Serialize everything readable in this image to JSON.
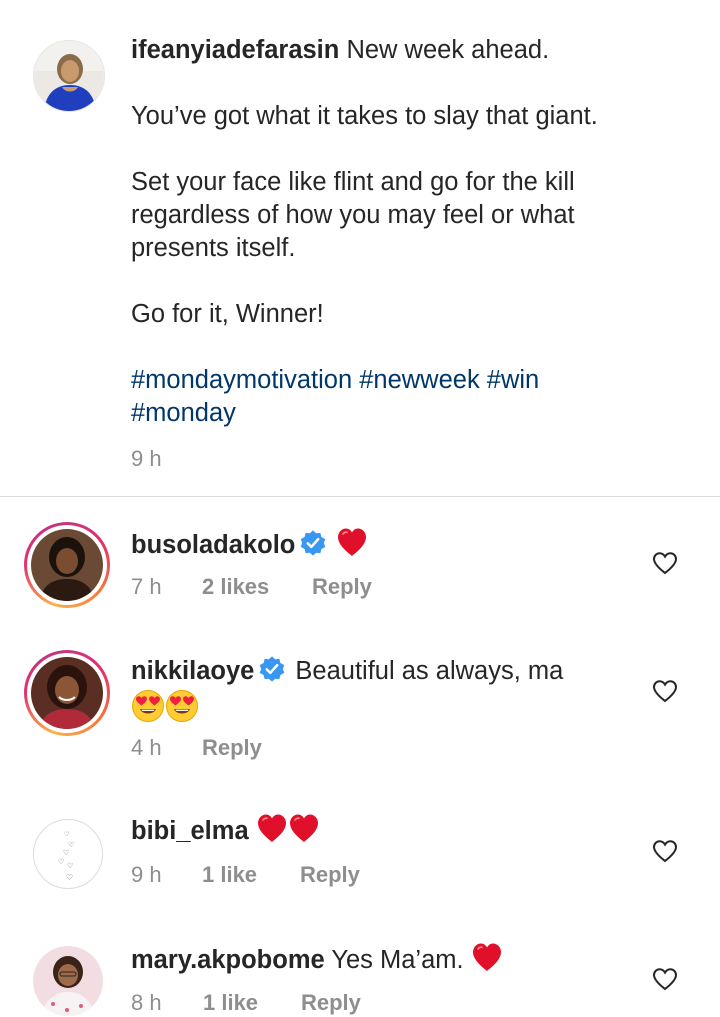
{
  "caption": {
    "username": "ifeanyiadefarasin",
    "first_line": "New week ahead.",
    "paragraph2": "You’ve got what it takes to slay that giant.",
    "paragraph3_line1": "Set your face like flint and go for the kill",
    "paragraph3_line2": "regardless of how you may feel or what",
    "paragraph3_line3": "presents itself.",
    "paragraph4": "Go for it, Winner!",
    "hashtags_line1": "#mondaymotivation #newweek #win",
    "hashtags_line2": "#monday",
    "time": "9 h"
  },
  "comments": [
    {
      "username": "busoladakolo",
      "verified": true,
      "text": "❤️",
      "time": "7 h",
      "likes": "2 likes",
      "reply": "Reply"
    },
    {
      "username": "nikkilaoye",
      "verified": true,
      "text": "Beautiful as always, ma",
      "text_line2": "😍😍",
      "time": "4 h",
      "reply": "Reply"
    },
    {
      "username": "bibi_elma",
      "verified": false,
      "text": "❤️❤️",
      "time": "9 h",
      "likes": "1 like",
      "reply": "Reply"
    },
    {
      "username": "mary.akpobome",
      "verified": false,
      "text": "Yes Ma’am.",
      "text_emoji": "❤️",
      "time": "8 h",
      "likes": "1 like",
      "reply": "Reply"
    }
  ],
  "colors": {
    "text": "#262626",
    "secondary": "#8e8e8e",
    "hashtag": "#00376b",
    "verified": "#3897f0",
    "heart": "#e0102a",
    "divider": "#dbdbdb"
  },
  "icons": {
    "like": "heart-outline-icon",
    "verified": "verified-badge-icon"
  }
}
